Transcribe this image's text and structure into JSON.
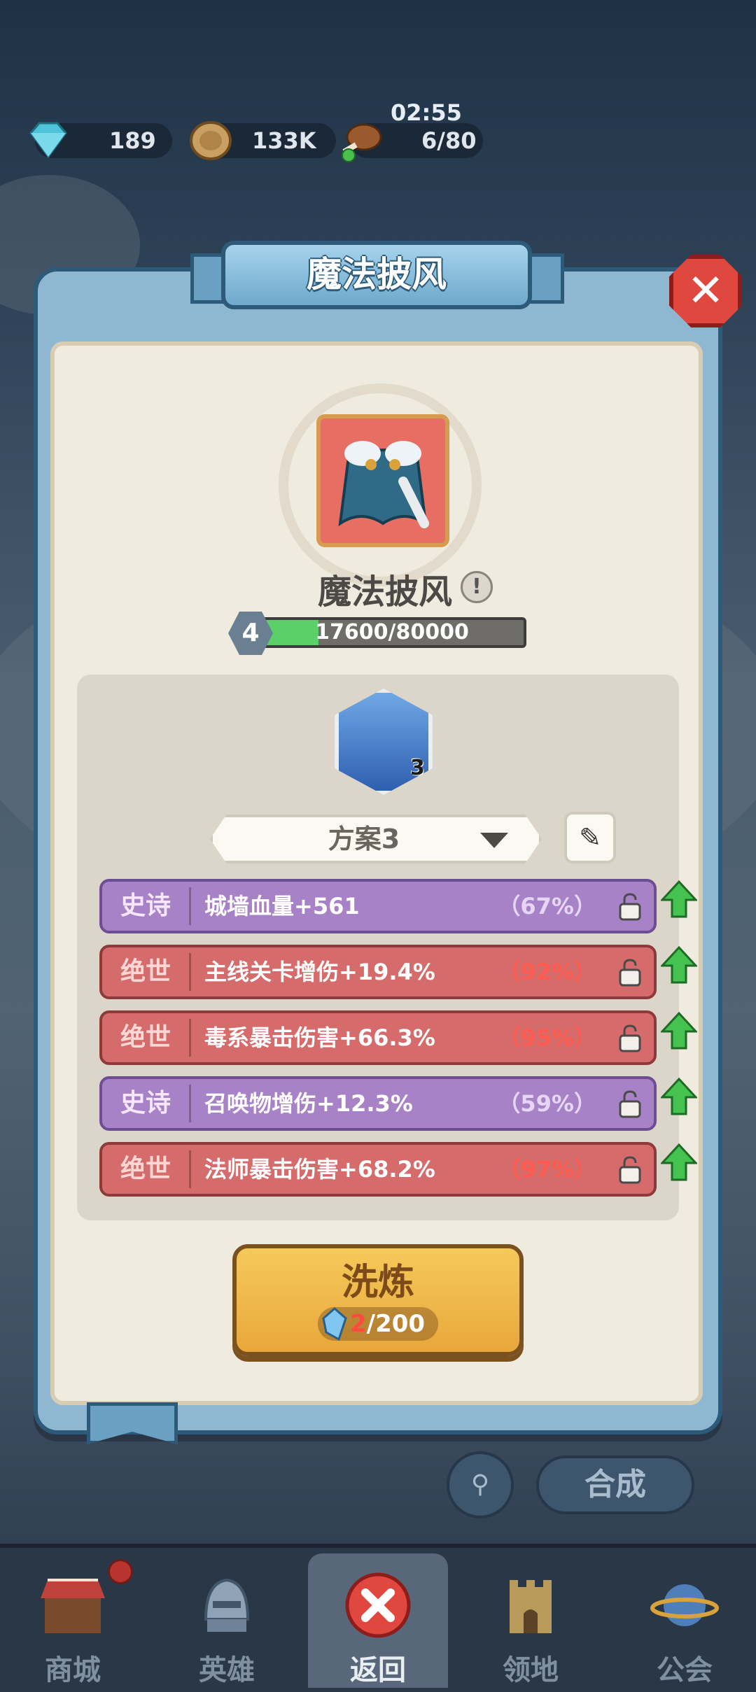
{
  "topbar": {
    "gems": "189",
    "coins": "133K",
    "stamina": "6/80",
    "timer": "02:55"
  },
  "dialog": {
    "title": "魔法披风",
    "item_name": "魔法披风",
    "level": "4",
    "xp_text": "17600/80000",
    "xp_progress": 0.22,
    "skill_count": "3",
    "plan_label": "方案3",
    "attributes": [
      {
        "tag": "史诗",
        "rarity": "epic",
        "text": "城墙血量+561",
        "pct": "（67%）"
      },
      {
        "tag": "绝世",
        "rarity": "legend",
        "text": "主线关卡增伤+19.4%",
        "pct": "（92%）"
      },
      {
        "tag": "绝世",
        "rarity": "legend",
        "text": "毒系暴击伤害+66.3%",
        "pct": "（95%）"
      },
      {
        "tag": "史诗",
        "rarity": "epic",
        "text": "召唤物增伤+12.3%",
        "pct": "（59%）"
      },
      {
        "tag": "绝世",
        "rarity": "legend",
        "text": "法师暴击伤害+68.2%",
        "pct": "（97%）"
      }
    ],
    "refine": {
      "label": "洗炼",
      "cost_current": "2",
      "cost_rest": "/200"
    }
  },
  "controls": {
    "combine_label": "合成"
  },
  "nav": [
    {
      "label": "商城",
      "icon": "shop-icon"
    },
    {
      "label": "英雄",
      "icon": "hero-helmet-icon"
    },
    {
      "label": "返回",
      "icon": "close-icon",
      "active": true
    },
    {
      "label": "领地",
      "icon": "castle-icon"
    },
    {
      "label": "公会",
      "icon": "planet-icon"
    }
  ],
  "colors": {
    "epic": "#a882c7",
    "legend": "#d56b6a",
    "xp_fill": "#5bd068",
    "refine_button": "#f0b84a"
  }
}
